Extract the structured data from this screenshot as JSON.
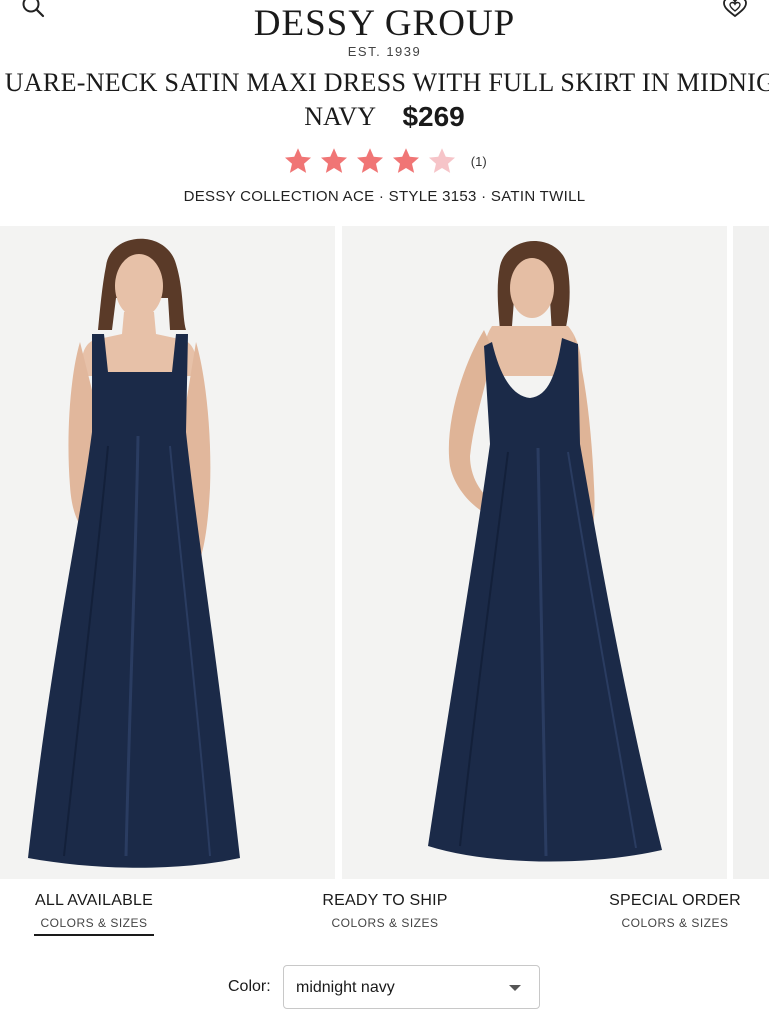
{
  "header": {
    "brand": "DESSY GROUP",
    "est": "EST. 1939",
    "search_icon": "search-icon",
    "heart_icon": "heart-icon"
  },
  "product": {
    "title_line1": "uare-Neck Satin Maxi Dress with Full Skirt in Midnig",
    "title_line2": "Navy",
    "price": "$269",
    "rating": {
      "value": 4,
      "max": 5,
      "count_text": "(1)"
    },
    "style_line": "DESSY COLLECTION ACE · STYLE 3153 · SATIN TWILL"
  },
  "colors": {
    "star_filled": "#f07575",
    "star_empty": "#f6c4c8",
    "dress": "#1b2a48",
    "photo_bg": "#f3f3f2"
  },
  "tabs": [
    {
      "label": "ALL AVAILABLE",
      "sub": "COLORS & SIZES",
      "active": true
    },
    {
      "label": "READY TO SHIP",
      "sub": "COLORS & SIZES",
      "active": false
    },
    {
      "label": "SPECIAL ORDER",
      "sub": "COLORS & SIZES",
      "active": false
    }
  ],
  "color_select": {
    "label": "Color:",
    "value": "midnight navy"
  }
}
